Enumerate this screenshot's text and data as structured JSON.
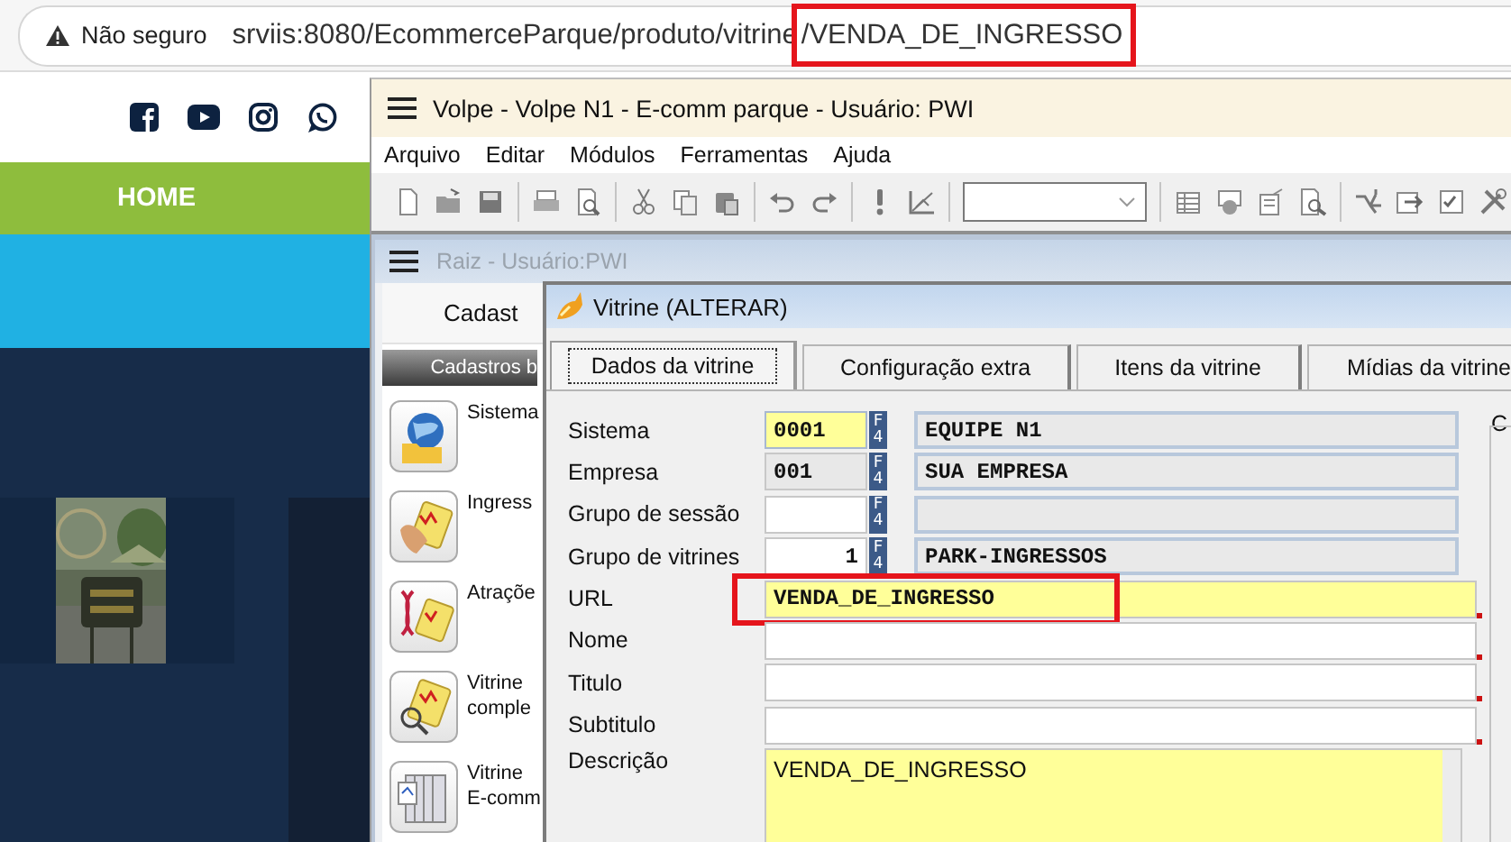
{
  "browser": {
    "security_label": "Não seguro",
    "url_parts": [
      {
        "text": "srviis:8080/EcommerceParque/produto/vitrine",
        "marked": false
      },
      {
        "text": "/VENDA_DE_INGRESSO",
        "marked": true
      }
    ]
  },
  "site": {
    "nav": [
      {
        "label": "HOME"
      }
    ]
  },
  "app": {
    "title": "Volpe - Volpe N1 - E-comm parque - Usuário: PWI",
    "menu": [
      "Arquivo",
      "Editar",
      "Módulos",
      "Ferramentas",
      "Ajuda"
    ]
  },
  "raiz": {
    "title": "Raiz - Usuário:PWI",
    "tab": "Cadast",
    "section": "Cadastros b",
    "items": [
      {
        "lines": [
          "Sistema"
        ]
      },
      {
        "lines": [
          "Ingress"
        ]
      },
      {
        "lines": [
          "Atraçõe"
        ]
      },
      {
        "lines": [
          "Vitrine",
          "comple"
        ]
      },
      {
        "lines": [
          "Vitrine",
          "E-comm"
        ]
      }
    ]
  },
  "dialog": {
    "title": "Vitrine (ALTERAR)",
    "tabs": [
      {
        "label": "Dados da vitrine",
        "selected": true
      },
      {
        "label": "Configuração extra",
        "selected": false
      },
      {
        "label": "Itens da vitrine",
        "selected": false
      },
      {
        "label": "Mídias da vitrine",
        "selected": false
      }
    ],
    "fields": [
      {
        "label": "Sistema",
        "kind": "lookup",
        "code": "0001",
        "key": "F4",
        "description": "EQUIPE N1",
        "highlighted": true,
        "readonly": false,
        "numeric": false
      },
      {
        "label": "Empresa",
        "kind": "lookup",
        "code": "001",
        "key": "F4",
        "description": "SUA EMPRESA",
        "highlighted": false,
        "readonly": true,
        "numeric": false
      },
      {
        "label": "Grupo de sessão",
        "kind": "lookup",
        "key": "F4",
        "highlighted": false,
        "readonly": false
      },
      {
        "label": "Grupo de vitrines",
        "kind": "lookup",
        "code": "1",
        "key": "F4",
        "description": "PARK-INGRESSOS",
        "highlighted": false,
        "readonly": false,
        "numeric": true
      },
      {
        "label": "URL",
        "kind": "text",
        "value": "VENDA_DE_INGRESSO",
        "highlighted": true,
        "required": true,
        "marked": true
      },
      {
        "label": "Nome",
        "kind": "text",
        "highlighted": false,
        "required": true,
        "marked": false
      },
      {
        "label": "Titulo",
        "kind": "text",
        "highlighted": false,
        "required": true,
        "marked": false
      },
      {
        "label": "Subtitulo",
        "kind": "text",
        "highlighted": false,
        "required": true,
        "marked": false
      },
      {
        "label": "Descrição",
        "kind": "memo",
        "value": "VENDA_DE_INGRESSO",
        "highlighted": true
      }
    ],
    "side_label": "C"
  }
}
